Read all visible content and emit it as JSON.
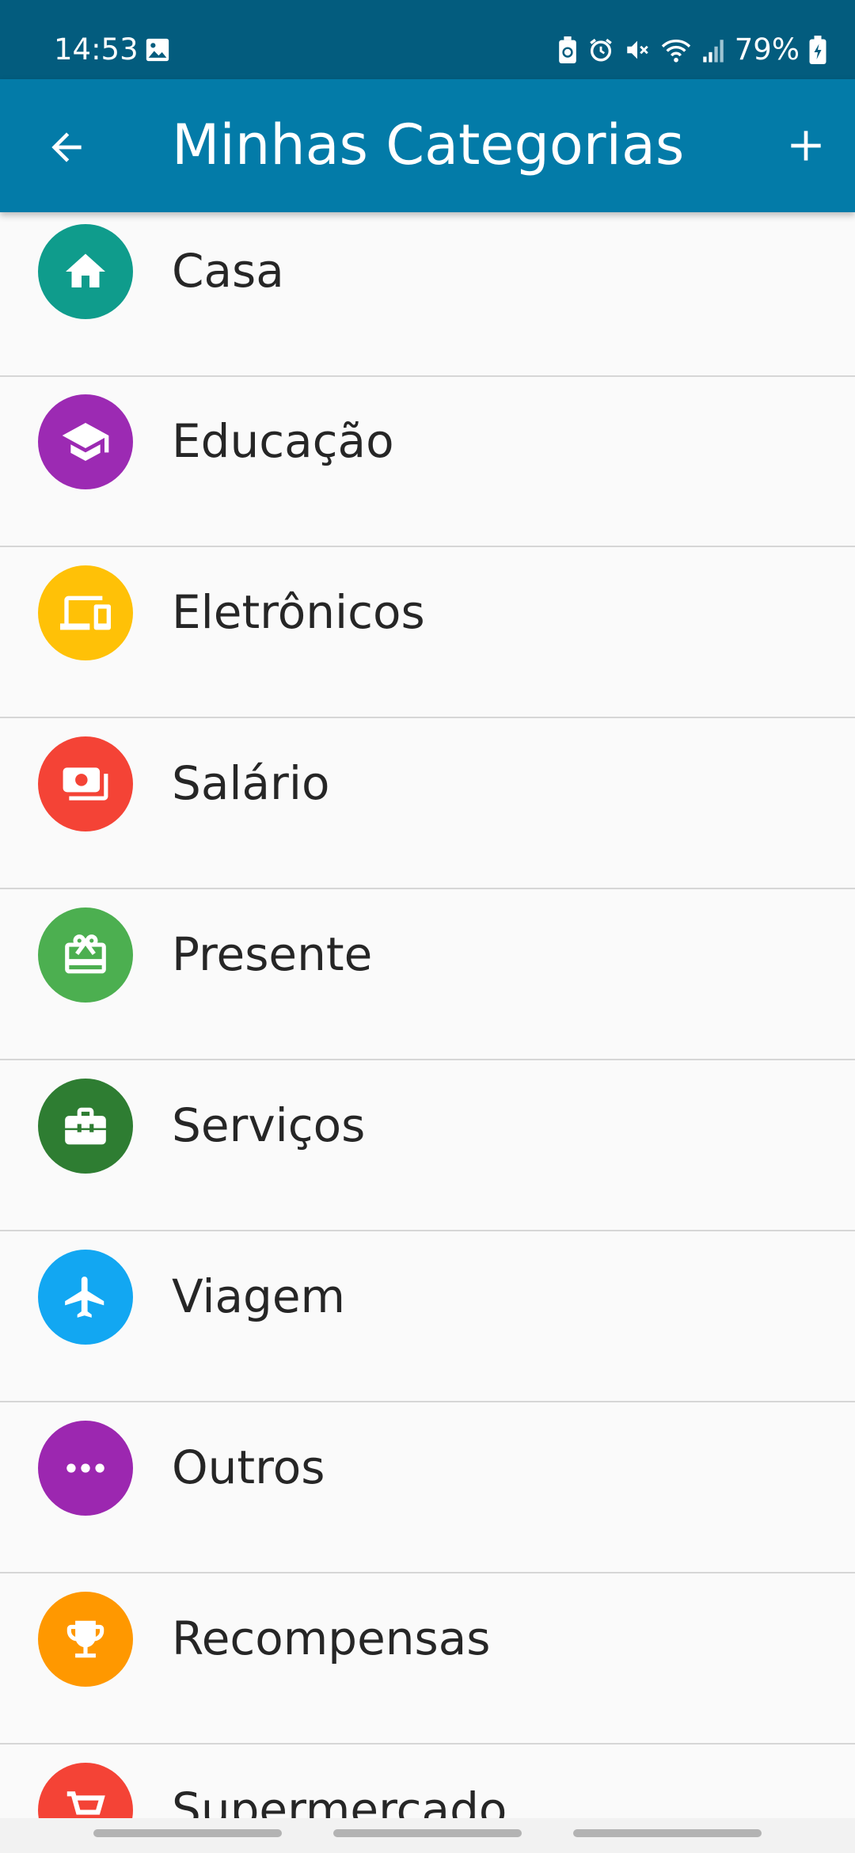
{
  "status_bar": {
    "time": "14:53",
    "battery": "79%",
    "icons": [
      "image-icon",
      "battery-saver-icon",
      "alarm-icon",
      "mute-icon",
      "wifi-icon",
      "signal-icon",
      "battery-icon"
    ]
  },
  "app_bar": {
    "title": "Minhas Categorias",
    "back_icon": "arrow-back-icon",
    "add_icon": "plus-icon",
    "color": "#037ba8"
  },
  "categories": [
    {
      "label": "Casa",
      "icon": "home-icon",
      "color": "#0f9c8c"
    },
    {
      "label": "Educação",
      "icon": "graduation-cap-icon",
      "color": "#9c2ab3"
    },
    {
      "label": "Eletrônicos",
      "icon": "devices-icon",
      "color": "#ffc107"
    },
    {
      "label": "Salário",
      "icon": "payments-icon",
      "color": "#f44336"
    },
    {
      "label": "Presente",
      "icon": "gift-card-icon",
      "color": "#4caf50"
    },
    {
      "label": "Serviços",
      "icon": "briefcase-icon",
      "color": "#2e7d32"
    },
    {
      "label": "Viagem",
      "icon": "airplane-icon",
      "color": "#12a7f2"
    },
    {
      "label": "Outros",
      "icon": "more-horiz-icon",
      "color": "#9c27b0"
    },
    {
      "label": "Recompensas",
      "icon": "trophy-icon",
      "color": "#ff9800"
    },
    {
      "label": "Supermercado",
      "icon": "cart-icon",
      "color": "#f44336"
    }
  ]
}
